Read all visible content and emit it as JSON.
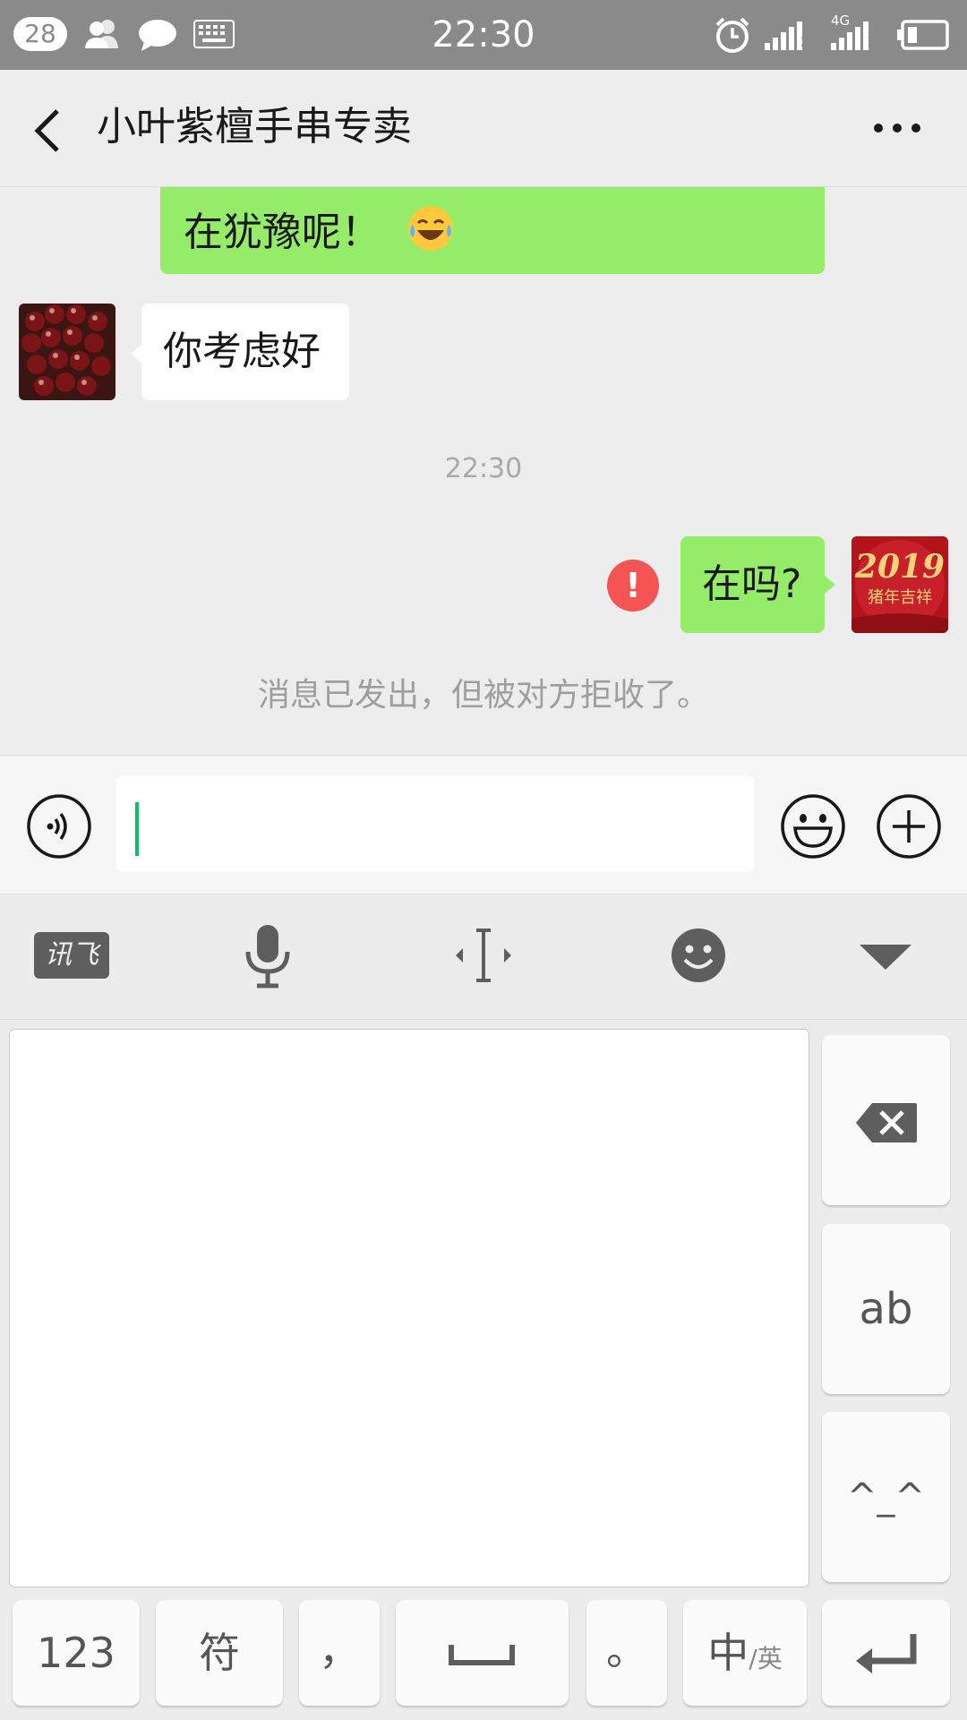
{
  "status_bar": {
    "notification_count": "28",
    "time": "22:30",
    "network": "4G",
    "sim1": "2",
    "sim2": "1"
  },
  "header": {
    "title": "小叶紫檀手串专卖"
  },
  "messages": {
    "sent_1": "在犹豫呢！",
    "received_1": "你考虑好",
    "timestamp": "22:30",
    "sent_2": "在吗?",
    "system_notice": "消息已发出，但被对方拒收了。",
    "error_mark": "!"
  },
  "avatars": {
    "self_text_line1": "2019",
    "self_text_line2": "猪年吉祥"
  },
  "keyboard_toolbar": {
    "ime_logo": "讯飞"
  },
  "keyboard": {
    "side_ab": "ab",
    "side_emoticon": "^_^",
    "key_123": "123",
    "key_symbol": "符",
    "key_comma": "，",
    "key_period": "。",
    "key_lang_main": "中",
    "key_lang_sub": "/英"
  },
  "colors": {
    "sent_bubble": "#95ec69",
    "error": "#f45454",
    "caret": "#07c160"
  }
}
